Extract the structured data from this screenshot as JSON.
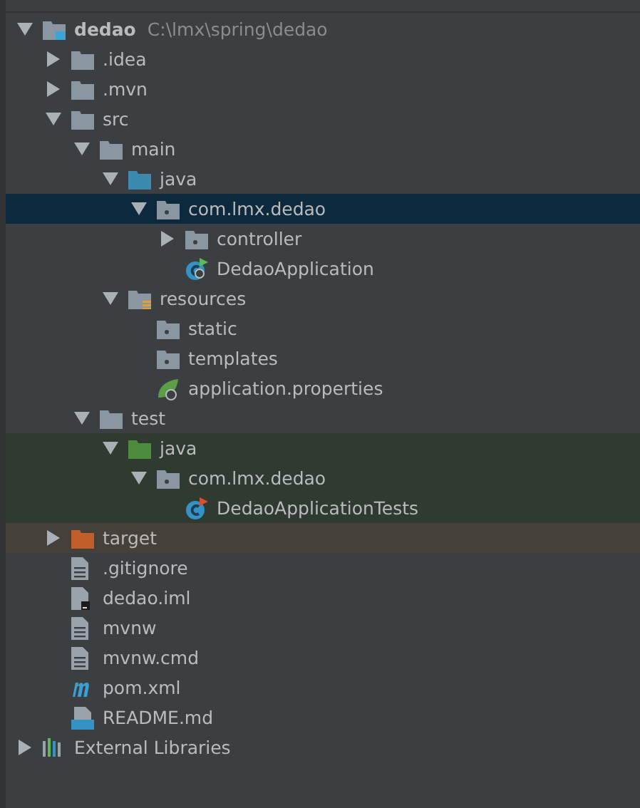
{
  "tree": [
    {
      "label": "dedao",
      "path": "C:\\lmx\\spring\\dedao",
      "kind": "module",
      "expanded": true,
      "selected": false,
      "children": [
        {
          "label": ".idea",
          "kind": "folder",
          "expanded": false,
          "selected": false
        },
        {
          "label": ".mvn",
          "kind": "folder",
          "expanded": false,
          "selected": false
        },
        {
          "label": "src",
          "kind": "folder",
          "expanded": true,
          "selected": false,
          "children": [
            {
              "label": "main",
              "kind": "folder",
              "expanded": true,
              "selected": false,
              "children": [
                {
                  "label": "java",
                  "kind": "source-folder",
                  "expanded": true,
                  "selected": false,
                  "children": [
                    {
                      "label": "com.lmx.dedao",
                      "kind": "package",
                      "expanded": true,
                      "selected": true,
                      "children": [
                        {
                          "label": "controller",
                          "kind": "package",
                          "expanded": false,
                          "selected": false
                        },
                        {
                          "label": "DedaoApplication",
                          "kind": "spring-class",
                          "selected": false
                        }
                      ]
                    }
                  ]
                },
                {
                  "label": "resources",
                  "kind": "resources-folder",
                  "expanded": true,
                  "selected": false,
                  "children": [
                    {
                      "label": "static",
                      "kind": "package",
                      "selected": false
                    },
                    {
                      "label": "templates",
                      "kind": "package",
                      "selected": false
                    },
                    {
                      "label": "application.properties",
                      "kind": "spring-config",
                      "selected": false
                    }
                  ]
                }
              ]
            },
            {
              "label": "test",
              "kind": "folder",
              "expanded": true,
              "selected": false,
              "children": [
                {
                  "label": "java",
                  "kind": "test-folder",
                  "color": "#2f3a31",
                  "expanded": true,
                  "selected": false,
                  "children": [
                    {
                      "label": "com.lmx.dedao",
                      "kind": "package",
                      "color": "#2f3a31",
                      "expanded": true,
                      "selected": false,
                      "children": [
                        {
                          "label": "DedaoApplicationTests",
                          "kind": "test-class",
                          "color": "#2f3a31",
                          "selected": false
                        }
                      ]
                    }
                  ]
                }
              ]
            }
          ]
        },
        {
          "label": "target",
          "kind": "excluded-folder",
          "color": "#45403a",
          "expanded": false,
          "selected": false
        },
        {
          "label": ".gitignore",
          "kind": "text-file",
          "selected": false
        },
        {
          "label": "dedao.iml",
          "kind": "iml-file",
          "selected": false
        },
        {
          "label": "mvnw",
          "kind": "text-file",
          "selected": false
        },
        {
          "label": "mvnw.cmd",
          "kind": "text-file",
          "selected": false
        },
        {
          "label": "pom.xml",
          "kind": "maven-file",
          "selected": false
        },
        {
          "label": "README.md",
          "kind": "markdown-file",
          "selected": false
        }
      ]
    },
    {
      "label": "External Libraries",
      "kind": "libraries",
      "expanded": false,
      "selected": false
    }
  ]
}
